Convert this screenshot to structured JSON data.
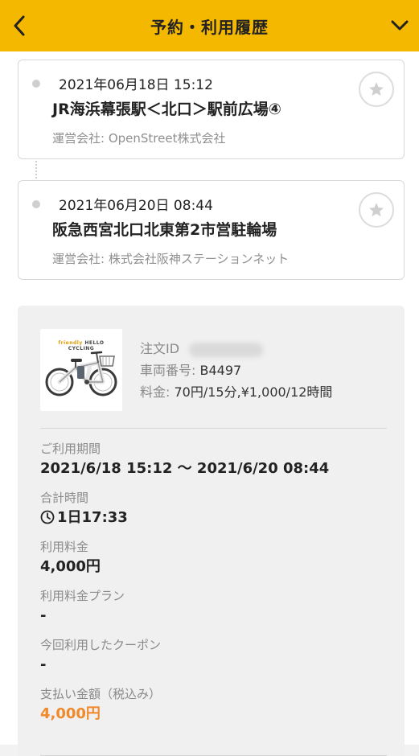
{
  "header": {
    "title": "予約・利用履歴"
  },
  "trips": [
    {
      "datetime": "2021年06月18日 15:12",
      "station": "JR海浜幕張駅＜北口＞駅前広場④",
      "operator": "運営会社: OpenStreet株式会社"
    },
    {
      "datetime": "2021年06月20日 08:44",
      "station": "阪急西宮北口北東第2市営駐輪場",
      "operator": "運営会社: 株式会社阪神ステーションネット"
    }
  ],
  "bike": {
    "brand": "HELLO CYCLING",
    "brand_prefix": "friendly",
    "order_label": "注文ID",
    "vehicle_label": "車両番号:",
    "vehicle_value": "B4497",
    "price_label": "料金:",
    "price_value": "70円/15分,¥1,000/12時間"
  },
  "details": {
    "period_label": "ご利用期間",
    "period_value": "2021/6/18 15:12 〜 2021/6/20 08:44",
    "total_time_label": "合計時間",
    "total_time_value": "1日17:33",
    "fee_label": "利用料金",
    "fee_value": "4,000円",
    "plan_label": "利用料金プラン",
    "plan_value": "-",
    "coupon_label": "今回利用したクーポン",
    "coupon_value": "-",
    "payment_label": "支払い金額（税込み）",
    "payment_value": "4,000円"
  },
  "colors": {
    "header": "#f5b800",
    "accent_orange": "#f0892a"
  },
  "icons": {
    "back": "chevron-left-icon",
    "menu": "chevron-down-icon",
    "favorite": "star-icon",
    "clock": "clock-icon"
  }
}
